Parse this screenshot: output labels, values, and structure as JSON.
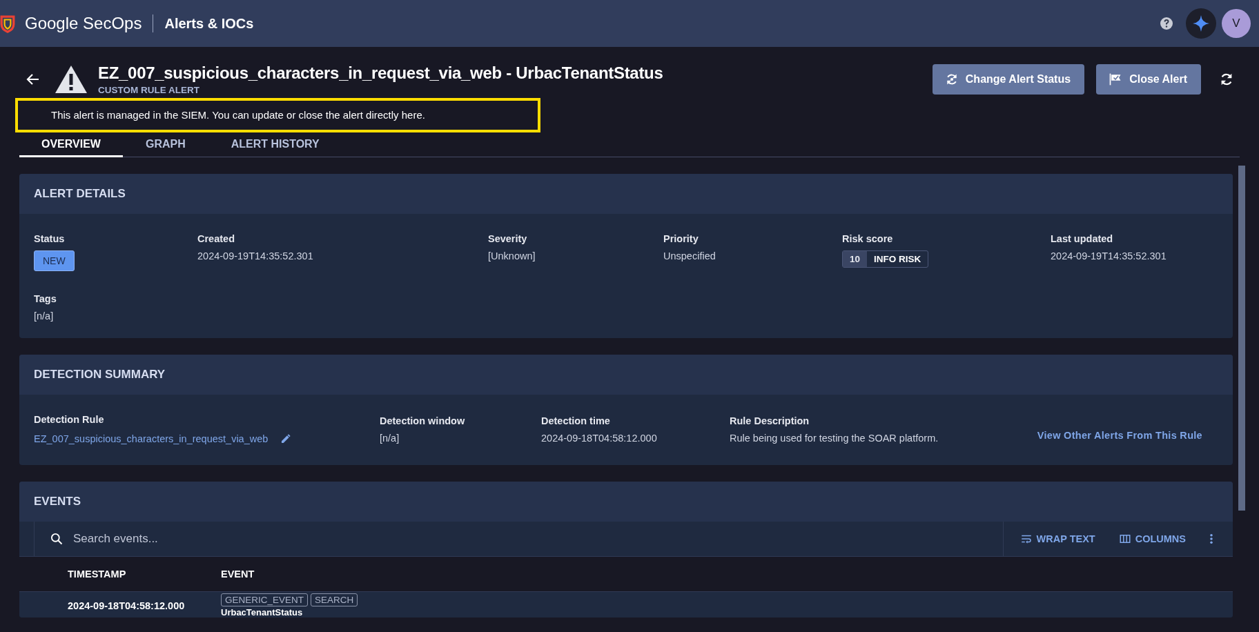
{
  "top_bar": {
    "brand": "Google SecOps",
    "page": "Alerts & IOCs",
    "avatar": "V"
  },
  "header": {
    "title": "EZ_007_suspicious_characters_in_request_via_web - UrbacTenantStatus",
    "subtitle": "CUSTOM RULE ALERT",
    "notice": "This alert is managed in the SIEM. You can update or close the alert directly here.",
    "notice_highlighted": true
  },
  "actions": [
    {
      "label": "Change Alert Status"
    },
    {
      "label": "Close Alert"
    }
  ],
  "tabs": [
    {
      "label": "OVERVIEW",
      "selected": true
    },
    {
      "label": "GRAPH",
      "selected": false
    },
    {
      "label": "ALERT HISTORY",
      "selected": false
    }
  ],
  "alert_details": {
    "title": "ALERT DETAILS",
    "fields": [
      {
        "label": "Status",
        "value": "NEW",
        "kind": "badge"
      },
      {
        "label": "Created",
        "value": "2024-09-19T14:35:52.301",
        "kind": "text"
      },
      {
        "label": "Severity",
        "value": "[Unknown]",
        "kind": "text"
      },
      {
        "label": "Priority",
        "value": "Unspecified",
        "kind": "text"
      },
      {
        "label": "Risk score",
        "score": "10",
        "value": "INFO RISK",
        "kind": "risk"
      },
      {
        "label": "Last updated",
        "value": "2024-09-19T14:35:52.301",
        "kind": "text"
      }
    ],
    "tags": {
      "label": "Tags",
      "value": "[n/a]"
    }
  },
  "detection_summary": {
    "title": "DETECTION SUMMARY",
    "fields": [
      {
        "label": "Detection Rule",
        "value": "EZ_007_suspicious_characters_in_request_via_web",
        "kind": "link"
      },
      {
        "label": "Detection window",
        "value": "[n/a]",
        "kind": "text"
      },
      {
        "label": "Detection time",
        "value": "2024-09-18T04:58:12.000",
        "kind": "text"
      },
      {
        "label": "Rule Description",
        "value": "Rule being used for testing the SOAR platform.",
        "kind": "text"
      }
    ],
    "link": "View Other Alerts From This Rule"
  },
  "events": {
    "title": "EVENTS",
    "search": {
      "placeholder": "Search events..."
    },
    "tools": [
      {
        "label": "WRAP TEXT"
      },
      {
        "label": "COLUMNS"
      }
    ],
    "columns": [
      "TIMESTAMP",
      "EVENT"
    ],
    "rows": [
      {
        "timestamp": "2024-09-18T04:58:12.000",
        "tags": [
          "GENERIC_EVENT",
          "SEARCH"
        ],
        "event": "UrbacTenantStatus"
      }
    ]
  }
}
